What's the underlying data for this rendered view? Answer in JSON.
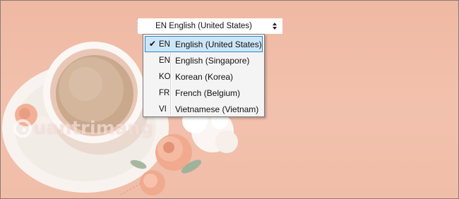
{
  "language_bar": {
    "current_label": "EN English (United States)"
  },
  "language_menu": {
    "items": [
      {
        "code": "EN",
        "name": "English (United States)",
        "selected": true,
        "check": "✔"
      },
      {
        "code": "EN",
        "name": "English (Singapore)",
        "selected": false
      },
      {
        "code": "KO",
        "name": "Korean (Korea)",
        "selected": false
      },
      {
        "code": "FR",
        "name": "French (Belgium)",
        "selected": false
      },
      {
        "code": "VI",
        "name": "Vietnamese (Vietnam)",
        "selected": false
      }
    ]
  },
  "watermark": {
    "text": "uantrimang"
  },
  "colors": {
    "wallpaper": "#f0bda8",
    "selection_fill": "#cde6f7",
    "selection_border": "#2f85c8",
    "menu_bg": "#f4f4f4"
  }
}
